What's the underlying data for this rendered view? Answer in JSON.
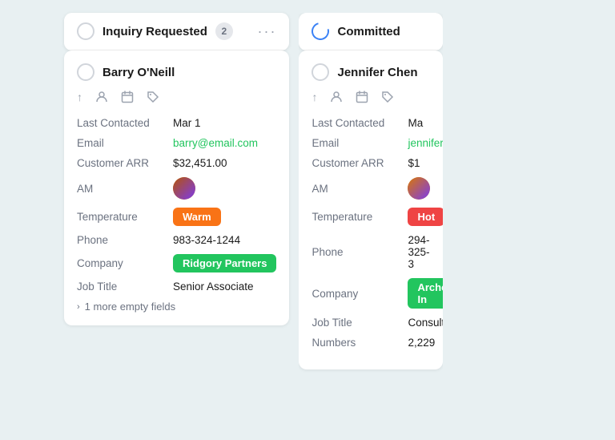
{
  "columns": [
    {
      "id": "inquiry-requested",
      "title": "Inquiry Requested",
      "badge": "2",
      "icon_type": "circle",
      "menu": "···",
      "cards": [
        {
          "id": "barry-oneill",
          "name": "Barry O'Neill",
          "last_contacted_label": "Last Contacted",
          "last_contacted_value": "Mar 1",
          "email_label": "Email",
          "email_value": "barry@email.com",
          "arr_label": "Customer ARR",
          "arr_value": "$32,451.00",
          "am_label": "AM",
          "temperature_label": "Temperature",
          "temperature_value": "Warm",
          "temperature_type": "warm",
          "phone_label": "Phone",
          "phone_value": "983-324-1244",
          "company_label": "Company",
          "company_value": "Ridgory Partners",
          "jobtitle_label": "Job Title",
          "jobtitle_value": "Senior Associate",
          "more_fields": "1 more empty fields"
        }
      ]
    },
    {
      "id": "committed",
      "title": "Committed",
      "badge": "",
      "icon_type": "committed",
      "menu": "",
      "cards": [
        {
          "id": "jennifer-chen",
          "name": "Jennifer Chen",
          "last_contacted_label": "Last Contacted",
          "last_contacted_value": "Ma",
          "email_label": "Email",
          "email_value": "jennifer@em",
          "arr_label": "Customer ARR",
          "arr_value": "$1",
          "am_label": "AM",
          "temperature_label": "Temperature",
          "temperature_value": "Hot",
          "temperature_type": "hot",
          "phone_label": "Phone",
          "phone_value": "294-325-3",
          "company_label": "Company",
          "company_value": "Archer In",
          "jobtitle_label": "Job Title",
          "jobtitle_value": "Consultin",
          "numbers_label": "Numbers",
          "numbers_value": "2,229"
        }
      ]
    }
  ],
  "icons": {
    "up_arrow": "↑",
    "person": "⊙",
    "calendar": "◫",
    "tag": "⊛",
    "chevron": "›"
  }
}
